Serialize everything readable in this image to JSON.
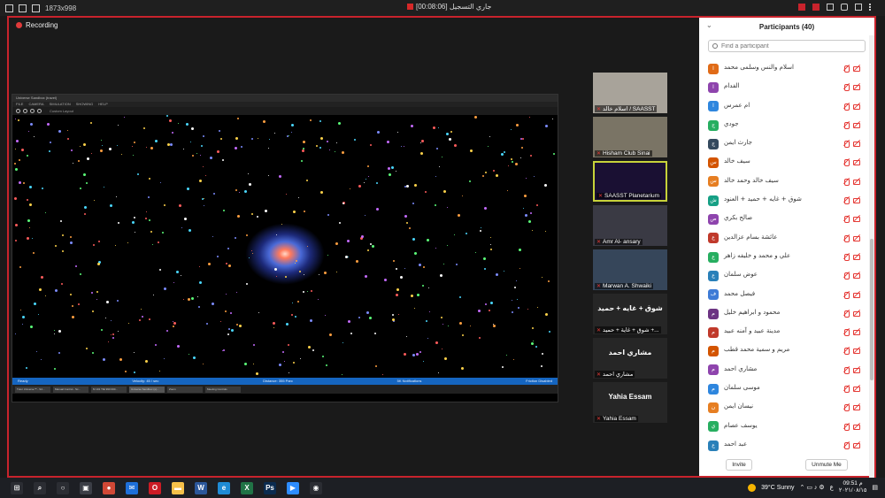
{
  "titlebar": {
    "dimensions": "1873x998",
    "status": "[00:08:06] جاري التسجيل"
  },
  "recording_label": "Recording",
  "share": {
    "title": "Universe Sandbox (travel)",
    "menu": [
      "FILE",
      "CAMERA",
      "SIMULATION",
      "SHOWING",
      "HELP"
    ],
    "toolbar_label": "Custom Layout",
    "status_left": "Ready",
    "status_mid1": "Velocity: 45 / sec",
    "status_mid2": "Distance: 355 Parc",
    "status_right1": "5K Notifications",
    "status_right2": "Friction Disabled",
    "tasks": [
      "Tutor Universe™ - S4...",
      "Manual Control - Sc...",
      "M 101 TIE 990 000...",
      "Universe Sandbox (s)...",
      "Zoom",
      "Meeting Controls"
    ]
  },
  "tiles": [
    {
      "name": "اسلام خالد / SAASST",
      "bg": "#a8a39a"
    },
    {
      "name": "Hisham Club Sinai",
      "bg": "#7a7465"
    },
    {
      "name": "SAASST Planetarium",
      "bg": "#1a1033"
    },
    {
      "name": "Amr Al- ansary",
      "bg": "#3a3a44"
    },
    {
      "name": "Marwan A. Shwaiki",
      "bg": "#36465a"
    },
    {
      "name": "شوق + غاية + حميد +...",
      "big": "شوق + غايه + حميد",
      "bg": "#262626"
    },
    {
      "name": "مشاري احمد",
      "big": "مشاري احمد",
      "bg": "#262626"
    },
    {
      "name": "Yahia Essam",
      "big": "Yahia Essam",
      "bg": "#262626"
    }
  ],
  "participants": {
    "title": "Participants (40)",
    "search_placeholder": "Find a participant",
    "items": [
      {
        "initial": "ا",
        "name": "اسلام والنس وسلمى محمد",
        "color": "#e06b17"
      },
      {
        "initial": "ا",
        "name": "الفدام",
        "color": "#8e44ad"
      },
      {
        "initial": "ا",
        "name": "ام عمرس",
        "color": "#2e86de"
      },
      {
        "initial": "ج",
        "name": "جودي",
        "color": "#27ae60"
      },
      {
        "initial": "ج",
        "name": "جارث ايمن",
        "color": "#34495e"
      },
      {
        "initial": "س",
        "name": "سيف خالد",
        "color": "#d35400"
      },
      {
        "initial": "س",
        "name": "سيف خالد وحمد خالد",
        "color": "#e67e22"
      },
      {
        "initial": "ش",
        "name": "شوق + غايه + حميد + العنود",
        "color": "#16a085"
      },
      {
        "initial": "ص",
        "name": "صالح بكري",
        "color": "#8e44ad"
      },
      {
        "initial": "ع",
        "name": "عائشة بسام عزالدين",
        "color": "#c0392b"
      },
      {
        "initial": "ع",
        "name": "علي و محمد و خليفه زاهر",
        "color": "#27ae60"
      },
      {
        "initial": "ع",
        "name": "عوض سلمان",
        "color": "#2980b9"
      },
      {
        "initial": "ف",
        "name": "فيصل محمد",
        "color": "#3e7bd6"
      },
      {
        "initial": "م",
        "name": "محمود و ابراهيم خليل",
        "color": "#6c3483"
      },
      {
        "initial": "م",
        "name": "مدينة عبيد و آمنه عبيد",
        "color": "#c0392b"
      },
      {
        "initial": "م",
        "name": "مريم و سمية محمد قطب",
        "color": "#d35400"
      },
      {
        "initial": "م",
        "name": "مشاري احمد",
        "color": "#8e44ad"
      },
      {
        "initial": "م",
        "name": "موسى سلمان",
        "color": "#2e86de"
      },
      {
        "initial": "ن",
        "name": "نيسان ايمن",
        "color": "#e67e22"
      },
      {
        "initial": "ي",
        "name": "يوسف عصام",
        "color": "#27ae60"
      },
      {
        "initial": "ع",
        "name": "عبد احمد",
        "color": "#2980b9"
      }
    ],
    "invite": "Invite",
    "unmute_me": "Unmute Me"
  },
  "taskbar": {
    "weather": "39°C Sunny",
    "time": "09:51 م",
    "date": "٢٠٢١/٠٨/١٥",
    "lang": "ع",
    "apps": [
      {
        "name": "start-icon",
        "color": "#2b2d33",
        "glyph": "⊞"
      },
      {
        "name": "search-icon",
        "color": "#2b2d33",
        "glyph": "⌕"
      },
      {
        "name": "cortana-icon",
        "color": "#2b2d33",
        "glyph": "○"
      },
      {
        "name": "store-icon",
        "color": "#3b3e46",
        "glyph": "▣"
      },
      {
        "name": "chrome-icon",
        "color": "#d14836",
        "glyph": "●"
      },
      {
        "name": "mail-icon",
        "color": "#1e6fd9",
        "glyph": "✉"
      },
      {
        "name": "opera-icon",
        "color": "#cc1b25",
        "glyph": "O"
      },
      {
        "name": "explorer-icon",
        "color": "#f5c04a",
        "glyph": "▬"
      },
      {
        "name": "word-icon",
        "color": "#2b579a",
        "glyph": "W"
      },
      {
        "name": "edge-icon",
        "color": "#1f8bd6",
        "glyph": "e"
      },
      {
        "name": "excel-icon",
        "color": "#217346",
        "glyph": "X"
      },
      {
        "name": "photoshop-icon",
        "color": "#0b2b4f",
        "glyph": "Ps"
      },
      {
        "name": "zoom-icon",
        "color": "#2d8cff",
        "glyph": "▶"
      },
      {
        "name": "record-icon",
        "color": "#2b2d33",
        "glyph": "◉"
      }
    ]
  }
}
